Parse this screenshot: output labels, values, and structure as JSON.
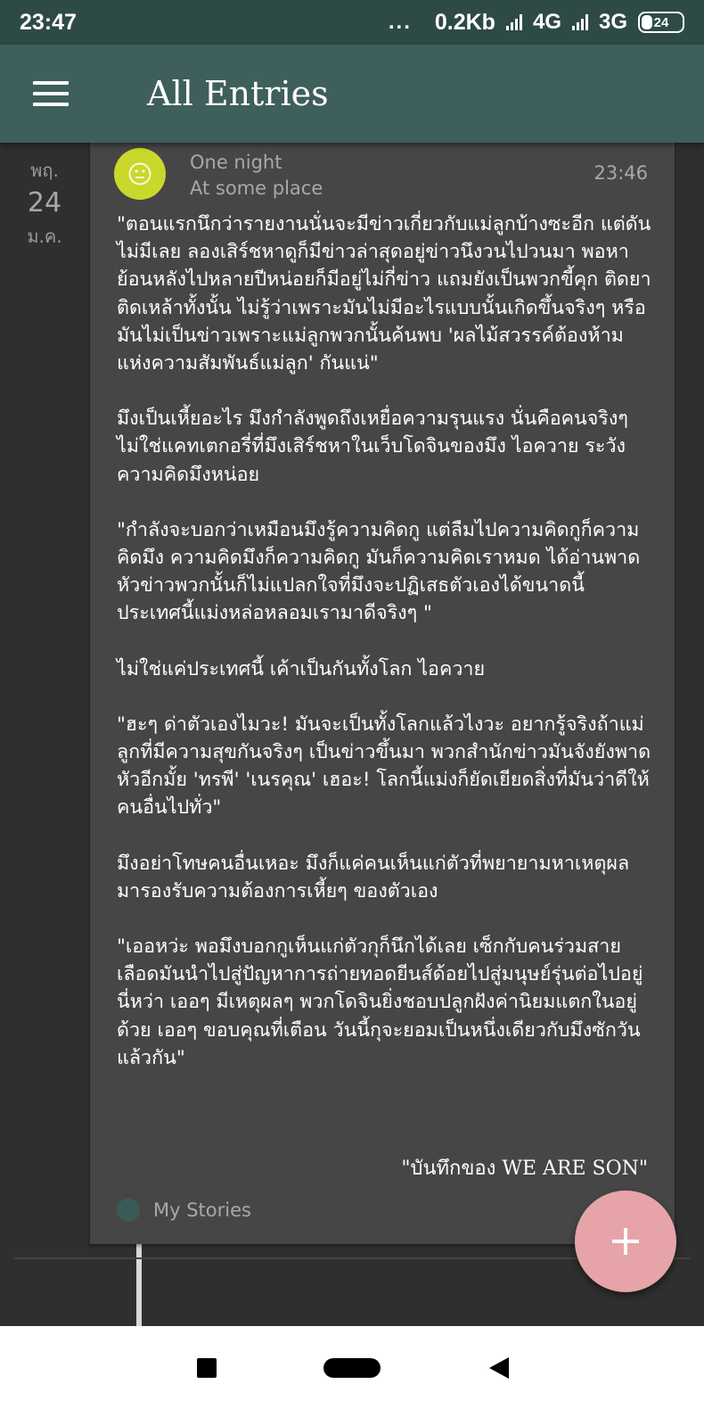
{
  "status_bar": {
    "time": "23:47",
    "dots": "...",
    "data_rate": "0.2Kb",
    "network_1": "4G",
    "network_2": "3G",
    "battery": "24"
  },
  "app_bar": {
    "title": "All Entries"
  },
  "date": {
    "day_of_week": "พฤ.",
    "day": "24",
    "month": "ม.ค."
  },
  "entry": {
    "title": "One night",
    "location": "At some place",
    "time": "23:46",
    "paragraphs": [
      "\"ตอนแรกนึกว่ารายงานนั่นจะมีข่าวเกี่ยวกับแม่ลูกบ้างซะอีก แต่ดันไม่มีเลย ลองเสิร์ชหาดูก็มีข่าวล่าสุดอยู่ข่าวนึงวนไปวนมา พอหาย้อนหลังไปหลายปีหน่อยก็มีอยู่ไม่กี่ข่าว แถมยังเป็นพวกขี้คุก ติดยา ติดเหล้าทั้งนั้น ไม่รู้ว่าเพราะมันไม่มีอะไรแบบนั้นเกิดขึ้นจริงๆ หรือมันไม่เป็นข่าวเพราะแม่ลูกพวกนั้นค้นพบ 'ผลไม้สวรรค์ต้องห้ามแห่งความสัมพันธ์แม่ลูก' กันแน่\"",
      "มึงเป็นเหี้ยอะไร มึงกำลังพูดถึงเหยื่อความรุนแรง นั่นคือคนจริงๆ ไม่ใช่แคทเตกอรี่ที่มึงเสิร์ชหาในเว็บโดจินของมึง ไอควาย ระวังความคิดมึงหน่อย",
      "\"กำลังจะบอกว่าเหมือนมึงรู้ความคิดกู แต่ลืมไปความคิดกูก็ความคิดมึง ความคิดมึงก็ความคิดกู มันก็ความคิดเราหมด ได้อ่านพาดหัวข่าวพวกนั้นก็ไม่แปลกใจที่มึงจะปฏิเสธตัวเองได้ขนาดนี้ ประเทศนี้แม่งหล่อหลอมเรามาดีจริงๆ \"",
      "ไม่ใช่แค่ประเทศนี้ เค้าเป็นกันทั้งโลก ไอควาย",
      "\"ฮะๆ ด่าตัวเองไมวะ! มันจะเป็นทั้งโลกแล้วไงวะ อยากรู้จริงถ้าแม่ลูกที่มีความสุขกันจริงๆ เป็นข่าวขึ้นมา พวกสำนักข่าวมันจังยังพาดหัวอีกมั้ย 'ทรพี' 'เนรคุณ' เฮอะ! โลกนี้แม่งก็ยัดเยียดสิ่งที่มันว่าดีให้คนอื่นไปทั่ว\"",
      "มึงอย่าโทษคนอื่นเหอะ มึงก็แค่คนเห็นแก่ตัวที่พยายามหาเหตุผลมารองรับความต้องการเหี้ยๆ ของตัวเอง",
      "\"เออหว่ะ พอมึงบอกกูเห็นแก่ตัวกุก็นึกได้เลย เซ็กกับคนร่วมสายเลือดมันนำไปสู่ปัญหาการถ่ายทอดยีนส์ด้อยไปสู่มนุษย์รุ่นต่อไปอยู่นี่หว่า เออๆ มีเหตุผลๆ พวกโดจินยิ่งชอบปลูกฝังค่านิยมแตกในอยู่ด้วย เออๆ ขอบคุณที่เตือน วันนี้กุจะยอมเป็นหนึ่งเดียวกับมึงซักวันแล้วกัน\""
    ],
    "signature": "\"บันทึกของ WE ARE SON\"",
    "tag": "My Stories"
  },
  "fab": {
    "label": "+"
  },
  "colors": {
    "status_bar": "#2e4a47",
    "app_bar": "#3e5f5b",
    "background": "#2f2f2f",
    "card": "#464646",
    "mood_icon": "#c9d82a",
    "fab": "#e6a4a9",
    "tag_dot": "#3a5a57"
  },
  "icons": {
    "menu": "hamburger-menu-icon",
    "mood": "neutral-face-icon",
    "fab": "plus-icon",
    "nav_recent": "square-recent-apps-icon",
    "nav_home": "pill-home-icon",
    "nav_back": "triangle-back-icon"
  }
}
